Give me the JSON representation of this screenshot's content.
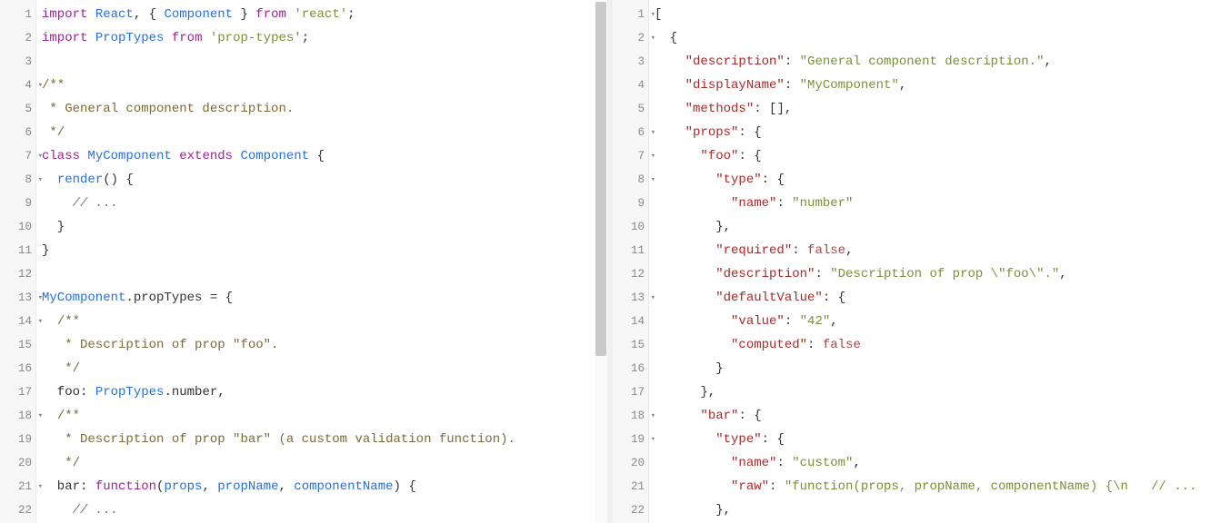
{
  "left": {
    "lines": [
      {
        "n": 1,
        "fold": "",
        "tokens": [
          [
            "kw",
            "import"
          ],
          [
            "pn",
            " "
          ],
          [
            "def",
            "React"
          ],
          [
            "pn",
            ", { "
          ],
          [
            "def",
            "Component"
          ],
          [
            "pn",
            " } "
          ],
          [
            "kw",
            "from"
          ],
          [
            "pn",
            " "
          ],
          [
            "str",
            "'react'"
          ],
          [
            "pn",
            ";"
          ]
        ]
      },
      {
        "n": 2,
        "fold": "",
        "tokens": [
          [
            "kw",
            "import"
          ],
          [
            "pn",
            " "
          ],
          [
            "def",
            "PropTypes"
          ],
          [
            "pn",
            " "
          ],
          [
            "kw",
            "from"
          ],
          [
            "pn",
            " "
          ],
          [
            "str",
            "'prop-types'"
          ],
          [
            "pn",
            ";"
          ]
        ]
      },
      {
        "n": 3,
        "fold": "",
        "tokens": [
          [
            "pn",
            ""
          ]
        ]
      },
      {
        "n": 4,
        "fold": "▾",
        "tokens": [
          [
            "doc",
            "/**"
          ]
        ]
      },
      {
        "n": 5,
        "fold": "",
        "tokens": [
          [
            "doc",
            " * General component description."
          ]
        ]
      },
      {
        "n": 6,
        "fold": "",
        "tokens": [
          [
            "doc",
            " */"
          ]
        ]
      },
      {
        "n": 7,
        "fold": "▾",
        "tokens": [
          [
            "kw",
            "class"
          ],
          [
            "pn",
            " "
          ],
          [
            "def",
            "MyComponent"
          ],
          [
            "pn",
            " "
          ],
          [
            "kw",
            "extends"
          ],
          [
            "pn",
            " "
          ],
          [
            "def",
            "Component"
          ],
          [
            "pn",
            " {"
          ]
        ]
      },
      {
        "n": 8,
        "fold": "▾",
        "tokens": [
          [
            "pn",
            "  "
          ],
          [
            "def",
            "render"
          ],
          [
            "pn",
            "() {"
          ]
        ]
      },
      {
        "n": 9,
        "fold": "",
        "tokens": [
          [
            "pn",
            "    "
          ],
          [
            "cmt",
            "// ..."
          ]
        ]
      },
      {
        "n": 10,
        "fold": "",
        "tokens": [
          [
            "pn",
            "  }"
          ]
        ]
      },
      {
        "n": 11,
        "fold": "",
        "tokens": [
          [
            "pn",
            "}"
          ]
        ]
      },
      {
        "n": 12,
        "fold": "",
        "tokens": [
          [
            "pn",
            ""
          ]
        ]
      },
      {
        "n": 13,
        "fold": "▾",
        "tokens": [
          [
            "def",
            "MyComponent"
          ],
          [
            "pn",
            ".propTypes = {"
          ]
        ]
      },
      {
        "n": 14,
        "fold": "▾",
        "tokens": [
          [
            "pn",
            "  "
          ],
          [
            "doc",
            "/**"
          ]
        ]
      },
      {
        "n": 15,
        "fold": "",
        "tokens": [
          [
            "pn",
            "  "
          ],
          [
            "doc",
            " * Description of prop \"foo\"."
          ]
        ]
      },
      {
        "n": 16,
        "fold": "",
        "tokens": [
          [
            "pn",
            "  "
          ],
          [
            "doc",
            " */"
          ]
        ]
      },
      {
        "n": 17,
        "fold": "",
        "tokens": [
          [
            "pn",
            "  foo: "
          ],
          [
            "def",
            "PropTypes"
          ],
          [
            "pn",
            ".number,"
          ]
        ]
      },
      {
        "n": 18,
        "fold": "▾",
        "tokens": [
          [
            "pn",
            "  "
          ],
          [
            "doc",
            "/**"
          ]
        ]
      },
      {
        "n": 19,
        "fold": "",
        "tokens": [
          [
            "pn",
            "  "
          ],
          [
            "doc",
            " * Description of prop \"bar\" (a custom validation function)."
          ]
        ]
      },
      {
        "n": 20,
        "fold": "",
        "tokens": [
          [
            "pn",
            "  "
          ],
          [
            "doc",
            " */"
          ]
        ]
      },
      {
        "n": 21,
        "fold": "▾",
        "tokens": [
          [
            "pn",
            "  bar: "
          ],
          [
            "kw",
            "function"
          ],
          [
            "pn",
            "("
          ],
          [
            "def",
            "props"
          ],
          [
            "pn",
            ", "
          ],
          [
            "def",
            "propName"
          ],
          [
            "pn",
            ", "
          ],
          [
            "def",
            "componentName"
          ],
          [
            "pn",
            ") {"
          ]
        ]
      },
      {
        "n": 22,
        "fold": "",
        "tokens": [
          [
            "pn",
            "    "
          ],
          [
            "cmt",
            "// ..."
          ]
        ]
      }
    ]
  },
  "right": {
    "lines": [
      {
        "n": 1,
        "fold": "▾",
        "tokens": [
          [
            "pn",
            "["
          ]
        ]
      },
      {
        "n": 2,
        "fold": "▾",
        "tokens": [
          [
            "pn",
            "  {"
          ]
        ]
      },
      {
        "n": 3,
        "fold": "",
        "tokens": [
          [
            "pn",
            "    "
          ],
          [
            "key",
            "\"description\""
          ],
          [
            "pn",
            ": "
          ],
          [
            "jstr",
            "\"General component description.\""
          ],
          [
            "pn",
            ","
          ]
        ]
      },
      {
        "n": 4,
        "fold": "",
        "tokens": [
          [
            "pn",
            "    "
          ],
          [
            "key",
            "\"displayName\""
          ],
          [
            "pn",
            ": "
          ],
          [
            "jstr",
            "\"MyComponent\""
          ],
          [
            "pn",
            ","
          ]
        ]
      },
      {
        "n": 5,
        "fold": "",
        "tokens": [
          [
            "pn",
            "    "
          ],
          [
            "key",
            "\"methods\""
          ],
          [
            "pn",
            ": [],"
          ]
        ]
      },
      {
        "n": 6,
        "fold": "▾",
        "tokens": [
          [
            "pn",
            "    "
          ],
          [
            "key",
            "\"props\""
          ],
          [
            "pn",
            ": {"
          ]
        ]
      },
      {
        "n": 7,
        "fold": "▾",
        "tokens": [
          [
            "pn",
            "      "
          ],
          [
            "key",
            "\"foo\""
          ],
          [
            "pn",
            ": {"
          ]
        ]
      },
      {
        "n": 8,
        "fold": "▾",
        "tokens": [
          [
            "pn",
            "        "
          ],
          [
            "key",
            "\"type\""
          ],
          [
            "pn",
            ": {"
          ]
        ]
      },
      {
        "n": 9,
        "fold": "",
        "tokens": [
          [
            "pn",
            "          "
          ],
          [
            "key",
            "\"name\""
          ],
          [
            "pn",
            ": "
          ],
          [
            "jstr",
            "\"number\""
          ]
        ]
      },
      {
        "n": 10,
        "fold": "",
        "tokens": [
          [
            "pn",
            "        },"
          ]
        ]
      },
      {
        "n": 11,
        "fold": "",
        "tokens": [
          [
            "pn",
            "        "
          ],
          [
            "key",
            "\"required\""
          ],
          [
            "pn",
            ": "
          ],
          [
            "jbool",
            "false"
          ],
          [
            "pn",
            ","
          ]
        ]
      },
      {
        "n": 12,
        "fold": "",
        "tokens": [
          [
            "pn",
            "        "
          ],
          [
            "key",
            "\"description\""
          ],
          [
            "pn",
            ": "
          ],
          [
            "jstr",
            "\"Description of prop \\\"foo\\\".\""
          ],
          [
            "pn",
            ","
          ]
        ]
      },
      {
        "n": 13,
        "fold": "▾",
        "tokens": [
          [
            "pn",
            "        "
          ],
          [
            "key",
            "\"defaultValue\""
          ],
          [
            "pn",
            ": {"
          ]
        ]
      },
      {
        "n": 14,
        "fold": "",
        "tokens": [
          [
            "pn",
            "          "
          ],
          [
            "key",
            "\"value\""
          ],
          [
            "pn",
            ": "
          ],
          [
            "jstr",
            "\"42\""
          ],
          [
            "pn",
            ","
          ]
        ]
      },
      {
        "n": 15,
        "fold": "",
        "tokens": [
          [
            "pn",
            "          "
          ],
          [
            "key",
            "\"computed\""
          ],
          [
            "pn",
            ": "
          ],
          [
            "jbool",
            "false"
          ]
        ]
      },
      {
        "n": 16,
        "fold": "",
        "tokens": [
          [
            "pn",
            "        }"
          ]
        ]
      },
      {
        "n": 17,
        "fold": "",
        "tokens": [
          [
            "pn",
            "      },"
          ]
        ]
      },
      {
        "n": 18,
        "fold": "▾",
        "tokens": [
          [
            "pn",
            "      "
          ],
          [
            "key",
            "\"bar\""
          ],
          [
            "pn",
            ": {"
          ]
        ]
      },
      {
        "n": 19,
        "fold": "▾",
        "tokens": [
          [
            "pn",
            "        "
          ],
          [
            "key",
            "\"type\""
          ],
          [
            "pn",
            ": {"
          ]
        ]
      },
      {
        "n": 20,
        "fold": "",
        "tokens": [
          [
            "pn",
            "          "
          ],
          [
            "key",
            "\"name\""
          ],
          [
            "pn",
            ": "
          ],
          [
            "jstr",
            "\"custom\""
          ],
          [
            "pn",
            ","
          ]
        ]
      },
      {
        "n": 21,
        "fold": "",
        "tokens": [
          [
            "pn",
            "          "
          ],
          [
            "key",
            "\"raw\""
          ],
          [
            "pn",
            ": "
          ],
          [
            "jstr",
            "\"function(props, propName, componentName) {\\n   // ..."
          ]
        ]
      },
      {
        "n": 22,
        "fold": "",
        "tokens": [
          [
            "pn",
            "        },"
          ]
        ]
      }
    ]
  }
}
